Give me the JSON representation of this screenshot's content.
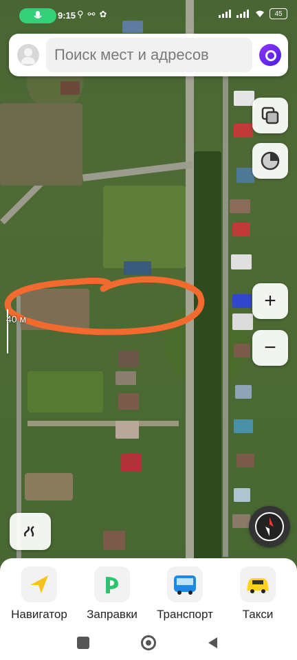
{
  "status": {
    "time": "9:15",
    "battery": "45"
  },
  "search": {
    "placeholder": "Поиск мест и адресов"
  },
  "map": {
    "scale_label": "40 м"
  },
  "controls": {
    "zoom_in": "+",
    "zoom_out": "−"
  },
  "services": [
    {
      "label": "Навигатор",
      "icon": "navigator-arrow-icon"
    },
    {
      "label": "Заправки",
      "icon": "fuel-icon"
    },
    {
      "label": "Транспорт",
      "icon": "bus-icon"
    },
    {
      "label": "Такси",
      "icon": "taxi-icon"
    }
  ],
  "colors": {
    "annotation": "#f26a2e",
    "mic_pill": "#35d07a",
    "alice_accent": "#7a2cff"
  }
}
